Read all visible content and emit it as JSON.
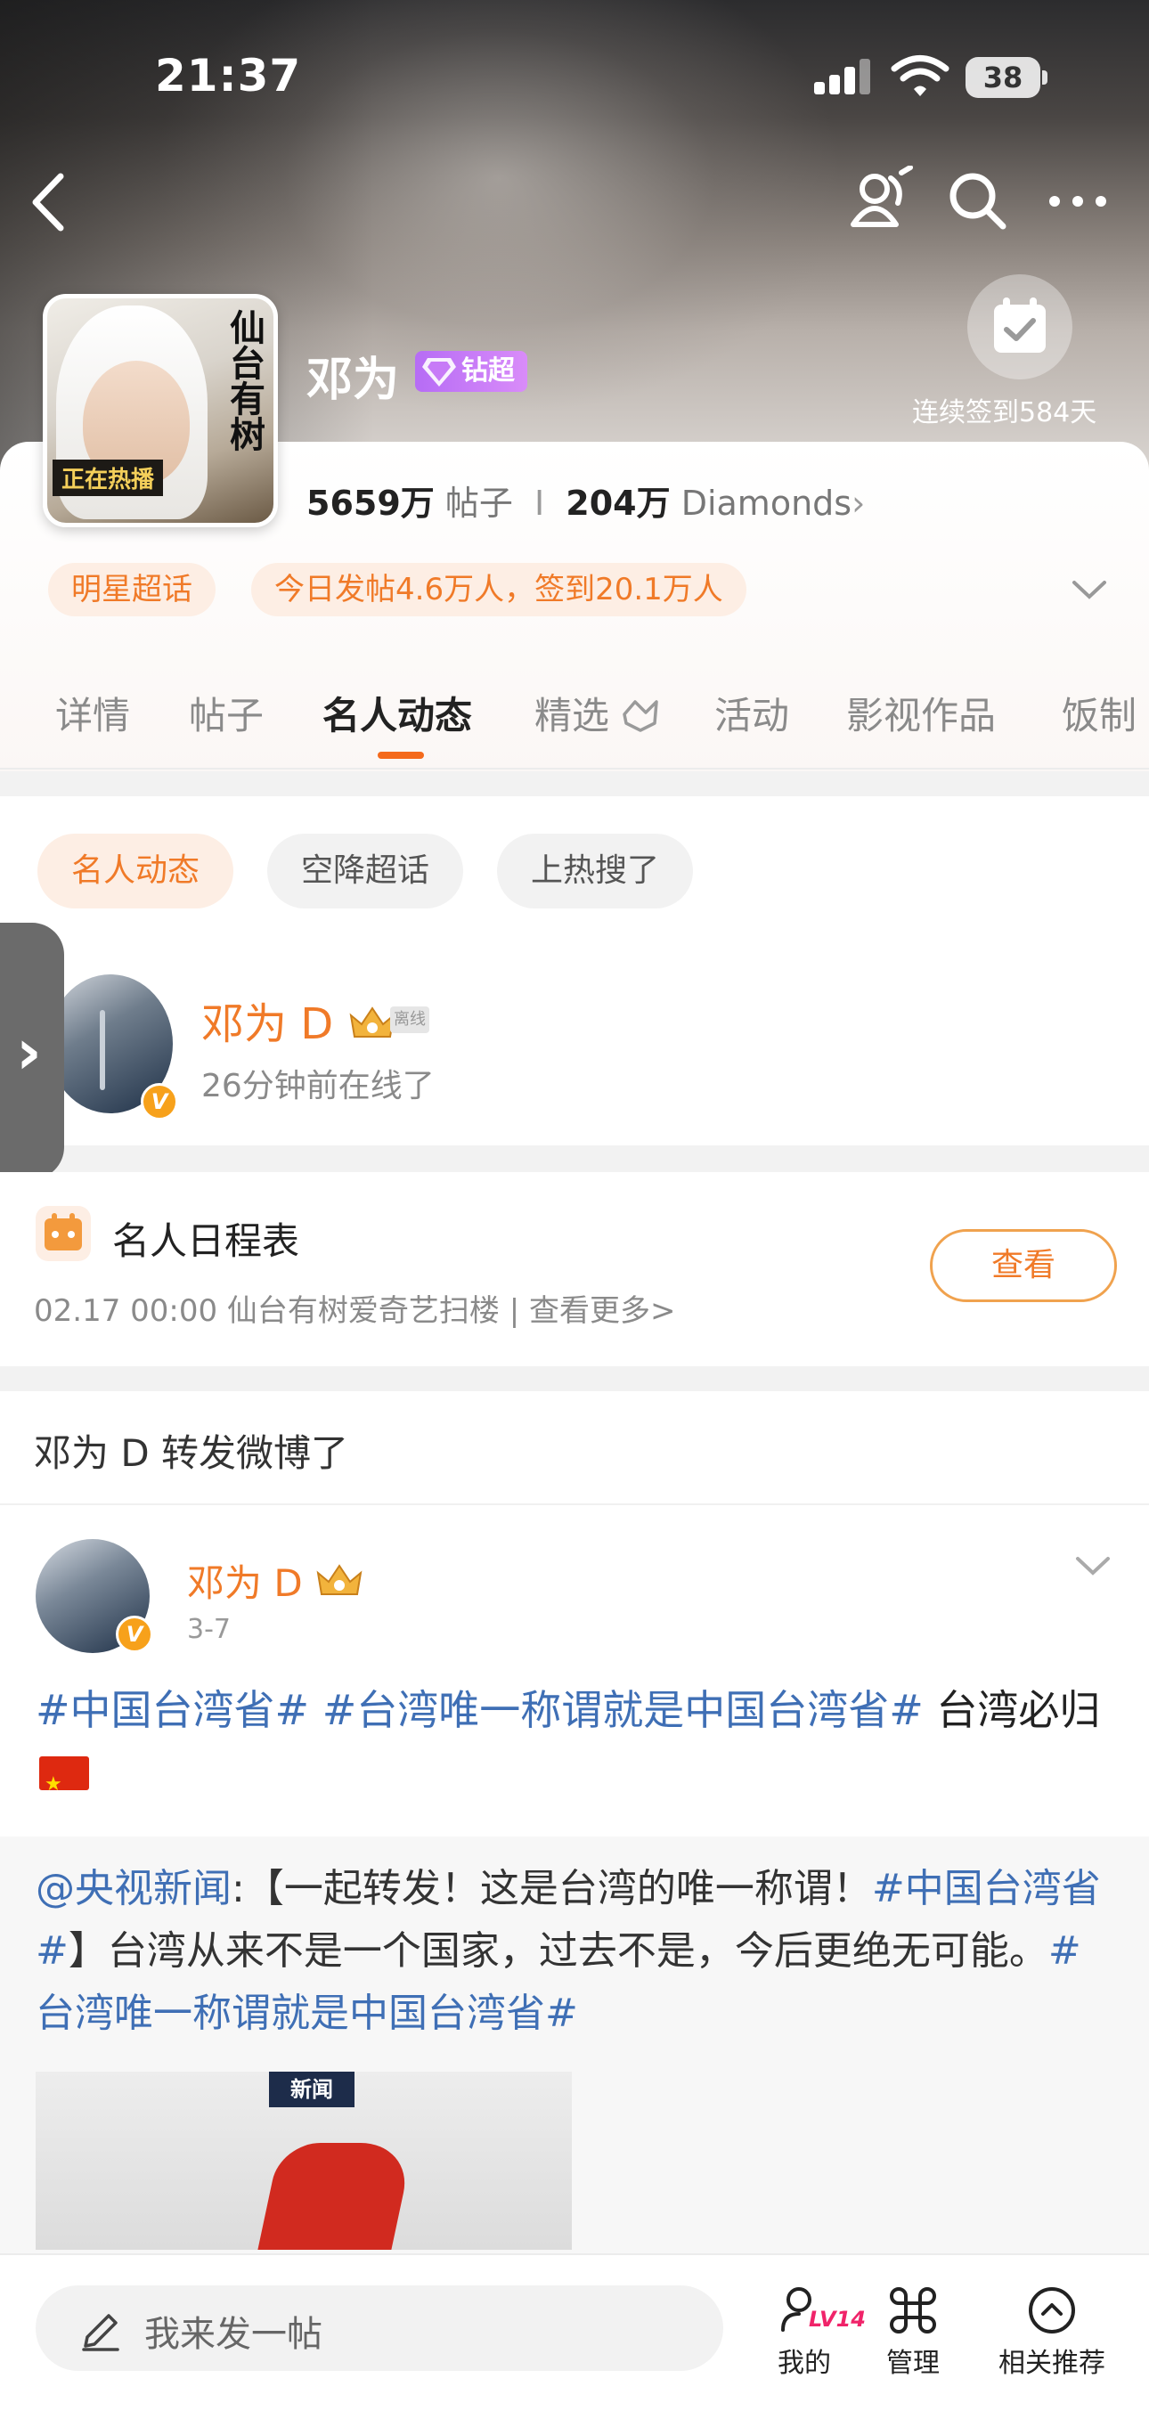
{
  "status_bar": {
    "time": "21:37",
    "battery": "38"
  },
  "profile": {
    "name": "邓为",
    "badge": "钻超",
    "poster_title": "仙台有树",
    "poster_hot": "正在热播",
    "checkin_text": "连续签到584天",
    "posts_count": "5659万",
    "posts_label": "帖子",
    "diamonds_count": "204万",
    "diamonds_label": "Diamonds",
    "tags": [
      "明星超话",
      "今日发帖4.6万人，签到20.1万人"
    ]
  },
  "tabs": [
    "详情",
    "帖子",
    "名人动态",
    "精选",
    "活动",
    "影视作品",
    "饭制"
  ],
  "active_tab": "名人动态",
  "sub_filters": [
    "名人动态",
    "空降超话",
    "上热搜了"
  ],
  "celebrity": {
    "name": "邓为 D",
    "offline_tag": "离线",
    "status": "26分钟前在线了"
  },
  "schedule": {
    "title": "名人日程表",
    "detail": "02.17 00:00 仙台有树爱奇艺扫楼 |  查看更多>",
    "view_button": "查看"
  },
  "feed": {
    "repost_label": "邓为 D 转发微博了",
    "post": {
      "author": "邓为 D",
      "time": "3-7",
      "hashtag1": "#中国台湾省#",
      "hashtag2": "#台湾唯一称谓就是中国台湾省#",
      "text": " 台湾必归"
    },
    "quoted": {
      "mention": "@央视新闻",
      "text_a": ":【一起转发！这是台湾的唯一称谓！",
      "hashtag1": "#中国台湾省#",
      "text_b": "】台湾从来不是一个国家，过去不是，今后更绝无可能。",
      "hashtag2": "#台湾唯一称谓就是中国台湾省#",
      "image_label": "新闻"
    }
  },
  "bottom_bar": {
    "compose_placeholder": "我来发一帖",
    "level": "LV14",
    "items": [
      "我的",
      "管理",
      "相关推荐"
    ]
  },
  "colors": {
    "accent": "#f07a28",
    "hashtag": "#3f6fb5",
    "badge": "#b66cf5"
  }
}
